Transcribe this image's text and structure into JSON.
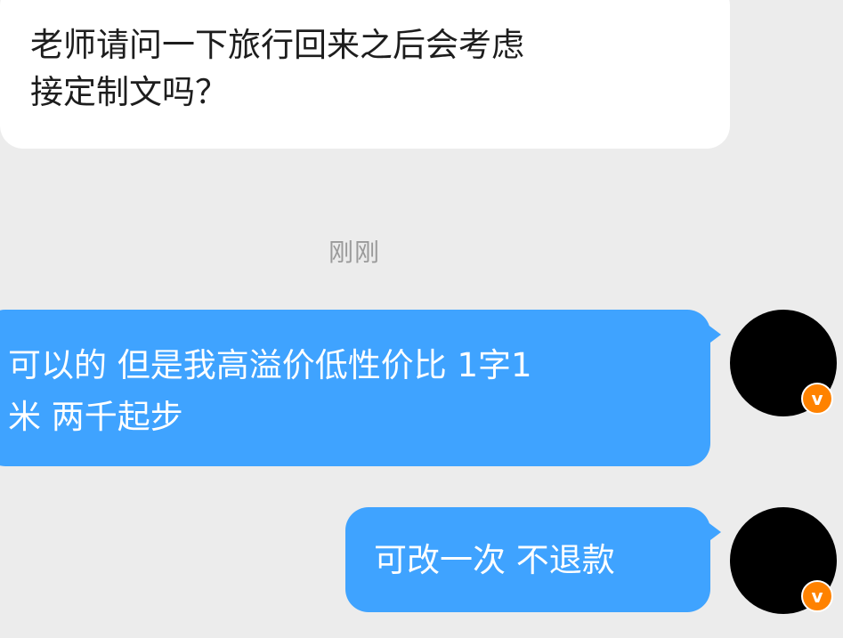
{
  "messages": [
    {
      "direction": "incoming",
      "lines": [
        "老师请问一下旅行回来之后会考虑",
        "接定制文吗？"
      ]
    },
    {
      "direction": "outgoing",
      "lines": [
        "可以的 但是我高溢价低性价比 1字1",
        "米 两千起步"
      ]
    },
    {
      "direction": "outgoing",
      "lines": [
        "可改一次 不退款"
      ]
    }
  ],
  "timestamp": "刚刚",
  "avatar": {
    "badge_text": "v",
    "badge_color": "#ff8200",
    "avatar_color": "#000000"
  },
  "colors": {
    "background": "#ececec",
    "incoming_bubble": "#ffffff",
    "outgoing_bubble": "#3fa3ff",
    "timestamp_text": "#9a9a9a"
  }
}
